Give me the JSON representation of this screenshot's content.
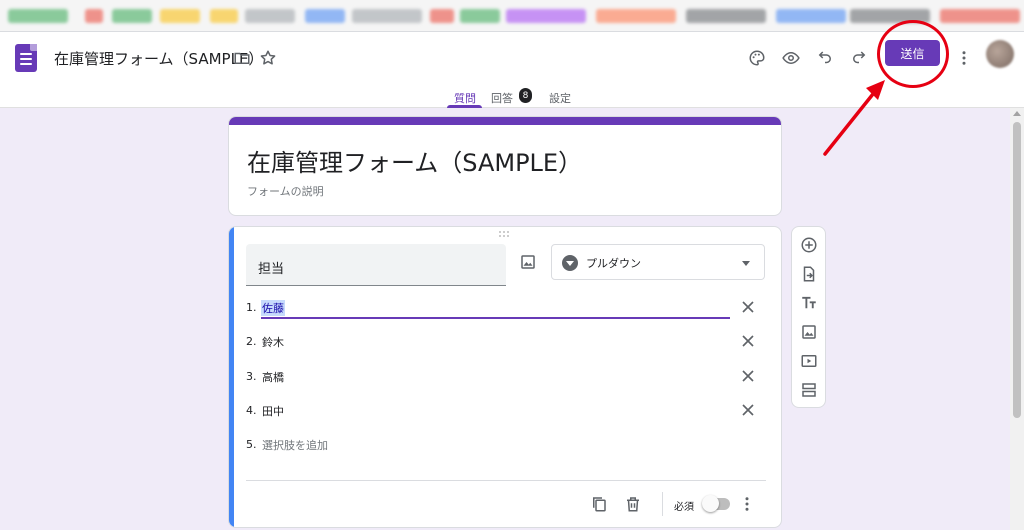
{
  "browser": {
    "bookmarks": [
      {
        "name": "bookmark-1",
        "color": "#34a853"
      },
      {
        "name": "bookmark-2",
        "color": "#ea4335"
      },
      {
        "name": "bookmark-3",
        "color": "#fbbc04"
      },
      {
        "name": "bookmark-4",
        "color": "#4285f4"
      }
    ]
  },
  "header": {
    "doc_title": "在庫管理フォーム（SAMPLE）",
    "send_label": "送信",
    "icons": [
      "folder-icon",
      "star-icon",
      "palette-icon",
      "preview-eye-icon",
      "undo-icon",
      "redo-icon",
      "more-vert-icon"
    ]
  },
  "tabs": {
    "questions": "質問",
    "responses": "回答",
    "responses_count": "8",
    "settings": "設定",
    "active": "questions"
  },
  "title_card": {
    "title": "在庫管理フォーム（SAMPLE）",
    "description_placeholder": "フォームの説明"
  },
  "question": {
    "title": "担当",
    "type": "プルダウン",
    "options": [
      {
        "num": "1.",
        "label": "佐藤",
        "selected": true
      },
      {
        "num": "2.",
        "label": "鈴木",
        "selected": false
      },
      {
        "num": "3.",
        "label": "高橋",
        "selected": false
      },
      {
        "num": "4.",
        "label": "田中",
        "selected": false
      }
    ],
    "add_option": {
      "num": "5.",
      "label": "選択肢を追加"
    },
    "required_label": "必須",
    "required": false
  },
  "side_toolbar": [
    "add-question-icon",
    "import-questions-icon",
    "add-title-icon",
    "add-image-icon",
    "add-video-icon",
    "add-section-icon"
  ],
  "colors": {
    "accent": "#673ab7",
    "background": "#f0ebf8",
    "active_card": "#4285f4",
    "annotation": "#e60012"
  }
}
